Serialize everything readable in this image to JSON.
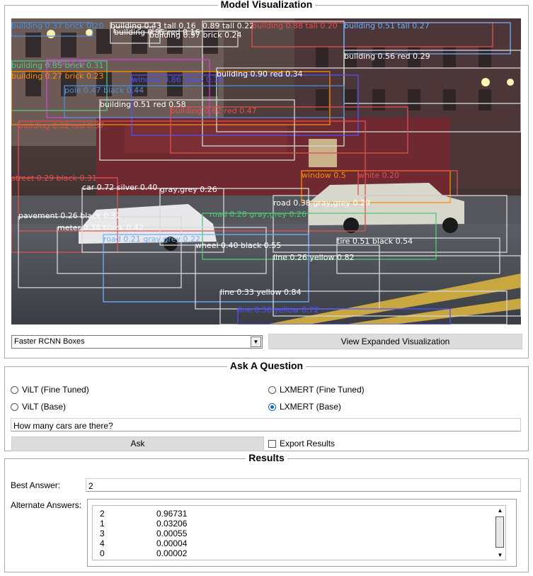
{
  "viz": {
    "title": "Model Visualization",
    "select_value": "Faster RCNN Boxes",
    "expand_button": "View Expanded Visualization",
    "detections": [
      {
        "label": "building 0.37 brick 0.20",
        "color": "#4a90d9"
      },
      {
        "label": "building 0.43 tall 0.16",
        "color": "#ffffff"
      },
      {
        "label": "building 0.95 red 0.16",
        "color": "#ffffff"
      },
      {
        "label": "building 0.97 brick 0.24",
        "color": "#ffffff"
      },
      {
        "label": "0.89 tall 0.22",
        "color": "#ffffff"
      },
      {
        "label": "building 0.88 tall 0.20",
        "color": "#e05050"
      },
      {
        "label": "building 0.51 tall 0.27",
        "color": "#6fb0ff"
      },
      {
        "label": "building 0.56 red 0.29",
        "color": "#ffffff"
      },
      {
        "label": "brick 0.24",
        "color": "#d040d0"
      },
      {
        "label": "building 0.85 brick 0.31",
        "color": "#50c878"
      },
      {
        "label": "building 0.27 brick 0.23",
        "color": "#ff8c00"
      },
      {
        "label": "window 0.86 glass 0.18",
        "color": "#5050ff"
      },
      {
        "label": "building 0.90 red 0.34",
        "color": "#ffffff"
      },
      {
        "label": "pole 0.47 black 0.44",
        "color": "#4a90d9"
      },
      {
        "label": "building 0.51 red 0.58",
        "color": "#ffffff"
      },
      {
        "label": "building 0.62 red 0.47",
        "color": "#e05050"
      },
      {
        "label": "building 0.32 red 0.37",
        "color": "#e05050"
      },
      {
        "label": "street 0.29 black 0.31",
        "color": "#e05050"
      },
      {
        "label": "window 0.5",
        "color": "#ff8c00"
      },
      {
        "label": "white 0.20",
        "color": "#e05050"
      },
      {
        "label": "car 0.72 silver 0.40",
        "color": "#ffffff"
      },
      {
        "label": "gray,grey 0.26",
        "color": "#ffffff"
      },
      {
        "label": "road 0.38 gray,grey 0.29",
        "color": "#ffffff"
      },
      {
        "label": "pavement 0.26 black 0.31",
        "color": "#ffffff"
      },
      {
        "label": "road 0.28 gray,grey 0.26",
        "color": "#50c878"
      },
      {
        "label": "meter 0.38 black 0.42",
        "color": "#ffffff"
      },
      {
        "label": "road 0.21 gray,grey 0.22",
        "color": "#6fb0ff"
      },
      {
        "label": "tire 0.51 black 0.54",
        "color": "#ffffff"
      },
      {
        "label": "wheel 0.40 black 0.55",
        "color": "#ffffff"
      },
      {
        "label": "line 0.26 yellow 0.82",
        "color": "#ffffff"
      },
      {
        "label": "line 0.33 yellow 0.84",
        "color": "#ffffff"
      },
      {
        "label": "line 0.36 yellow 0.72",
        "color": "#5050ff"
      }
    ]
  },
  "ask": {
    "title": "Ask A Question",
    "models": [
      {
        "label": "ViLT (Fine Tuned)",
        "selected": false
      },
      {
        "label": "LXMERT (Fine Tuned)",
        "selected": false
      },
      {
        "label": "ViLT (Base)",
        "selected": false
      },
      {
        "label": "LXMERT (Base)",
        "selected": true
      }
    ],
    "question": "How many cars are there?",
    "ask_button": "Ask",
    "export_label": "Export Results",
    "export_checked": false
  },
  "results": {
    "title": "Results",
    "best_label": "Best Answer:",
    "best_value": "2",
    "alt_label": "Alternate Answers:",
    "alternates": [
      {
        "answer": "2",
        "score": "0.96731"
      },
      {
        "answer": "1",
        "score": "0.03206"
      },
      {
        "answer": "3",
        "score": "0.00055"
      },
      {
        "answer": "4",
        "score": "0.00004"
      },
      {
        "answer": "0",
        "score": "0.00002"
      }
    ]
  }
}
